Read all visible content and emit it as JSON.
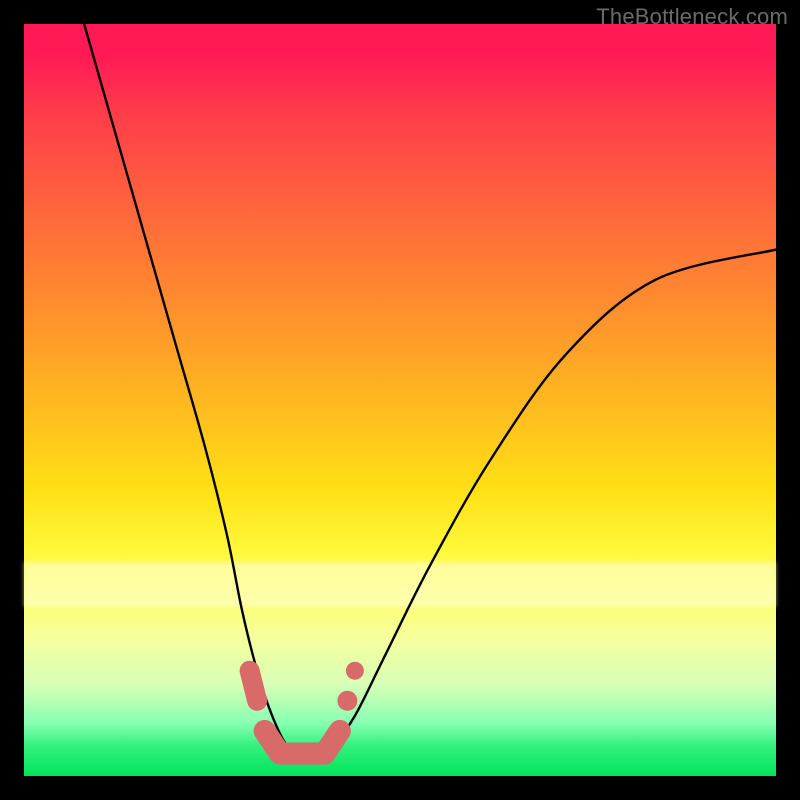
{
  "watermark": "TheBottleneck.com",
  "colors": {
    "curve": "#000000",
    "marker": "#d86a6a",
    "marker_stroke": "#c85a5a"
  },
  "chart_data": {
    "type": "line",
    "title": "",
    "xlabel": "",
    "ylabel": "",
    "xlim": [
      0,
      100
    ],
    "ylim": [
      0,
      100
    ],
    "series": [
      {
        "name": "bottleneck-curve",
        "x": [
          8,
          12,
          16,
          20,
          24,
          27,
          29,
          31,
          33,
          35,
          37,
          39,
          41,
          44,
          48,
          54,
          62,
          72,
          84,
          100
        ],
        "y": [
          100,
          86,
          72,
          58,
          44,
          32,
          22,
          14,
          8,
          4,
          3,
          3,
          4,
          8,
          16,
          28,
          42,
          56,
          66,
          70
        ]
      }
    ],
    "markers": {
      "name": "highlighted-range",
      "points": [
        {
          "x": 30,
          "y": 14
        },
        {
          "x": 31,
          "y": 10
        },
        {
          "x": 32,
          "y": 6
        },
        {
          "x": 34,
          "y": 3
        },
        {
          "x": 36,
          "y": 3
        },
        {
          "x": 38,
          "y": 3
        },
        {
          "x": 40,
          "y": 3
        },
        {
          "x": 42,
          "y": 6
        },
        {
          "x": 43,
          "y": 10
        },
        {
          "x": 44,
          "y": 14
        }
      ]
    }
  }
}
